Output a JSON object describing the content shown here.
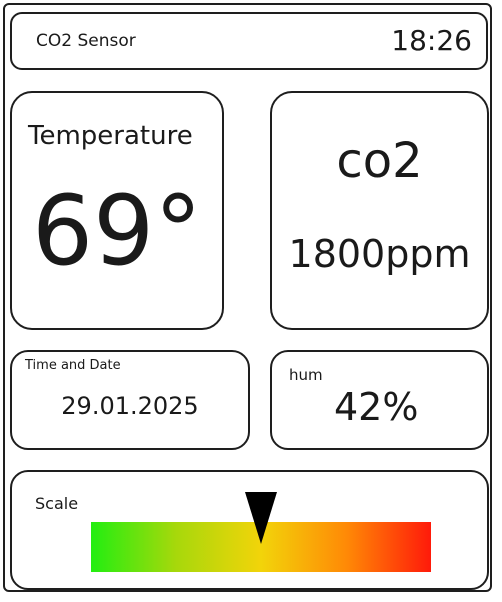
{
  "header": {
    "title": "CO2 Sensor",
    "time": "18:26"
  },
  "temperature": {
    "label": "Temperature",
    "value": "69°"
  },
  "co2": {
    "label": "co2",
    "value": "1800ppm"
  },
  "datetime": {
    "label": "Time and Date",
    "value": "29.01.2025"
  },
  "humidity": {
    "label": "hum",
    "value": "42%"
  },
  "scale": {
    "label": "Scale",
    "indicator_fraction": 0.5,
    "gradient_colors": [
      "#22ee11",
      "#a7d80b",
      "#f2d40a",
      "#ff8a06",
      "#ff1a0a"
    ]
  }
}
